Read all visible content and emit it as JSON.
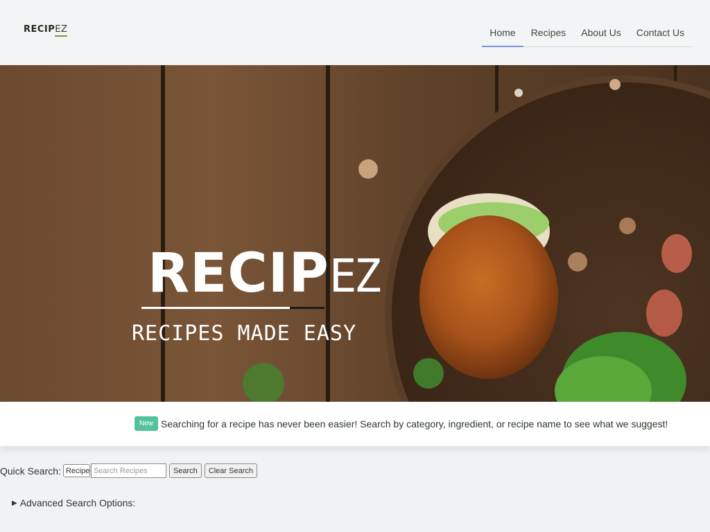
{
  "header": {
    "logo_main": "RECIP",
    "logo_ez": "EZ",
    "nav": [
      {
        "label": "Home",
        "active": true
      },
      {
        "label": "Recipes",
        "active": false
      },
      {
        "label": "About Us",
        "active": false
      },
      {
        "label": "Contact Us",
        "active": false
      }
    ]
  },
  "hero": {
    "title_main": "RECIP",
    "title_ez": "EZ",
    "tagline": "RECIPES MADE EASY"
  },
  "notice": {
    "badge": "New",
    "text": "Searching for a recipe has never been easier! Search by category, ingredient, or recipe name to see what we suggest!"
  },
  "quick_search": {
    "label": "Quick Search:",
    "select_value": "Recipe",
    "placeholder": "Search Recipes",
    "search_button": "Search",
    "clear_button": "Clear Search"
  },
  "advanced": {
    "label": "Advanced Search Options:"
  },
  "colors": {
    "badge": "#52c39e",
    "nav_active_underline": "#7b8fd6",
    "wood": "#5b3e28"
  }
}
